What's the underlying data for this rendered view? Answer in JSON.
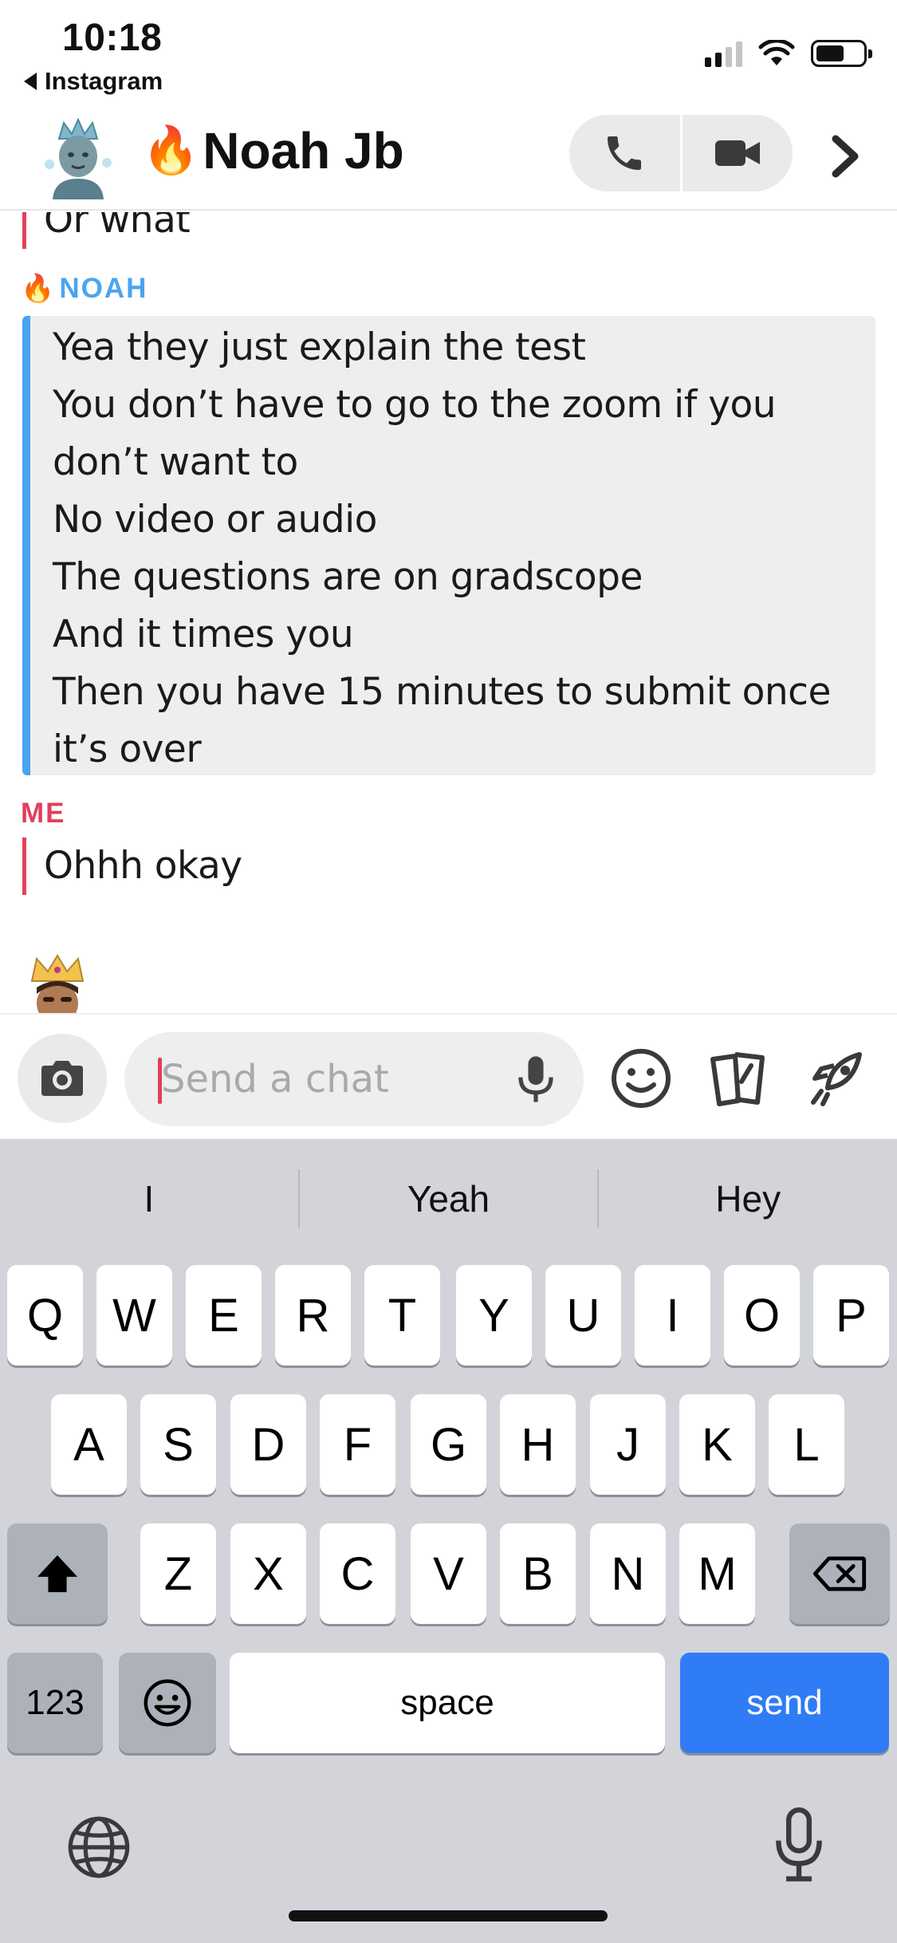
{
  "status_bar": {
    "time": "10:18",
    "back_app": "Instagram"
  },
  "header": {
    "chat_name": "Noah Jb",
    "name_emoji": "🔥",
    "call_icon": "phone-icon",
    "video_icon": "video-camera-icon"
  },
  "messages": {
    "previous_tail": "Or what",
    "noah_sender": "NOAH",
    "noah_lines": [
      "Yea they just explain the test",
      "You don’t have to go to the zoom if you",
      "don’t want to",
      "No video or audio",
      "The questions are on gradscope",
      "And it times you",
      "Then you have 15 minutes to submit once",
      "it’s over"
    ],
    "me_sender": "ME",
    "me_lines": [
      "Ohhh okay"
    ]
  },
  "compose": {
    "placeholder": "Send a chat"
  },
  "keyboard": {
    "suggestions": [
      "I",
      "Yeah",
      "Hey"
    ],
    "row1": [
      "Q",
      "W",
      "E",
      "R",
      "T",
      "Y",
      "U",
      "I",
      "O",
      "P"
    ],
    "row2": [
      "A",
      "S",
      "D",
      "F",
      "G",
      "H",
      "J",
      "K",
      "L"
    ],
    "row3": [
      "Z",
      "X",
      "C",
      "V",
      "B",
      "N",
      "M"
    ],
    "numbers_label": "123",
    "space_label": "space",
    "send_label": "send"
  },
  "colors": {
    "accent_red": "#e0405a",
    "accent_blue": "#4aa4f0",
    "send_blue": "#2f7cf6"
  }
}
